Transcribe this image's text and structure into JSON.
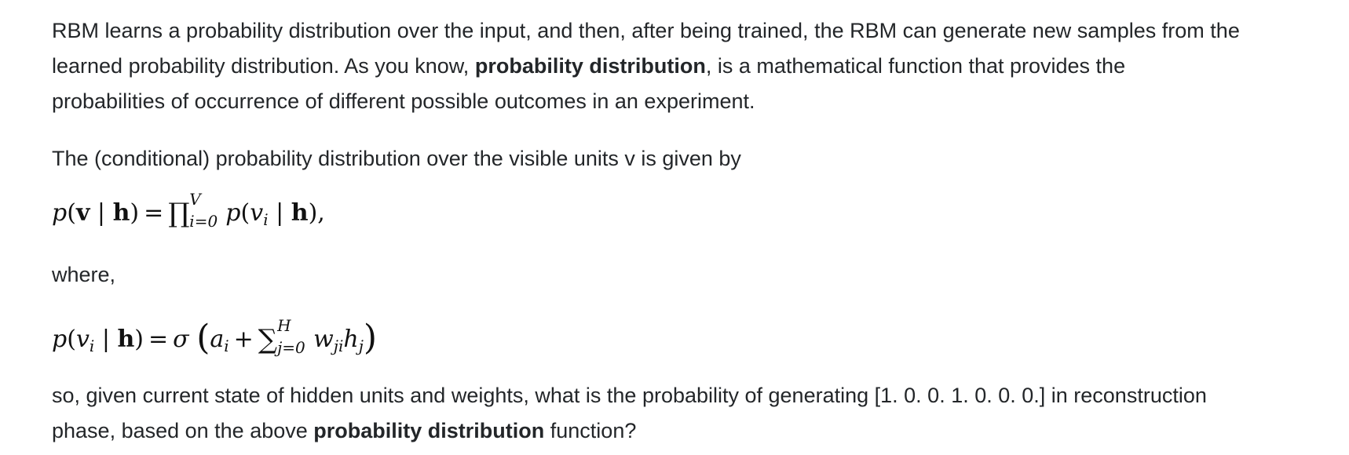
{
  "paragraph1": {
    "text_a": "RBM learns a probability distribution over the input, and then, after being trained, the RBM can generate new samples from the",
    "text_b": "learned probability distribution. As you know, ",
    "bold": "probability distribution",
    "text_c": ", is a mathematical function that provides the",
    "text_d": "probabilities of occurrence of different possible outcomes in an experiment."
  },
  "paragraph2": {
    "text": "The (conditional) probability distribution over the visible units v is given by"
  },
  "equation1": {
    "lhs_p": "p",
    "lhs_v": "v",
    "lhs_h": "h",
    "prod_symbol": "∏",
    "upper": "V",
    "lower": "i=0",
    "rhs_p": "p",
    "rhs_v": "v",
    "rhs_sub": "i",
    "rhs_h": "h",
    "trail": "),"
  },
  "paragraph3": {
    "text": "where,"
  },
  "equation2": {
    "lhs_p": "p",
    "lhs_v": "v",
    "lhs_sub": "i",
    "lhs_h": "h",
    "sigma": "σ",
    "a": "a",
    "a_sub": "i",
    "sum_symbol": "∑",
    "upper": "H",
    "lower": "j=0",
    "w": "w",
    "w_sub": "ji",
    "hvar": "h",
    "h_sub": "j"
  },
  "paragraph4": {
    "text_a": "so, given current state of hidden units and weights, what is the probability of generating [1. 0. 0. 1. 0. 0. 0.] in reconstruction",
    "text_b": "phase, based on the above ",
    "bold": "probability distribution",
    "text_c": " function?"
  }
}
